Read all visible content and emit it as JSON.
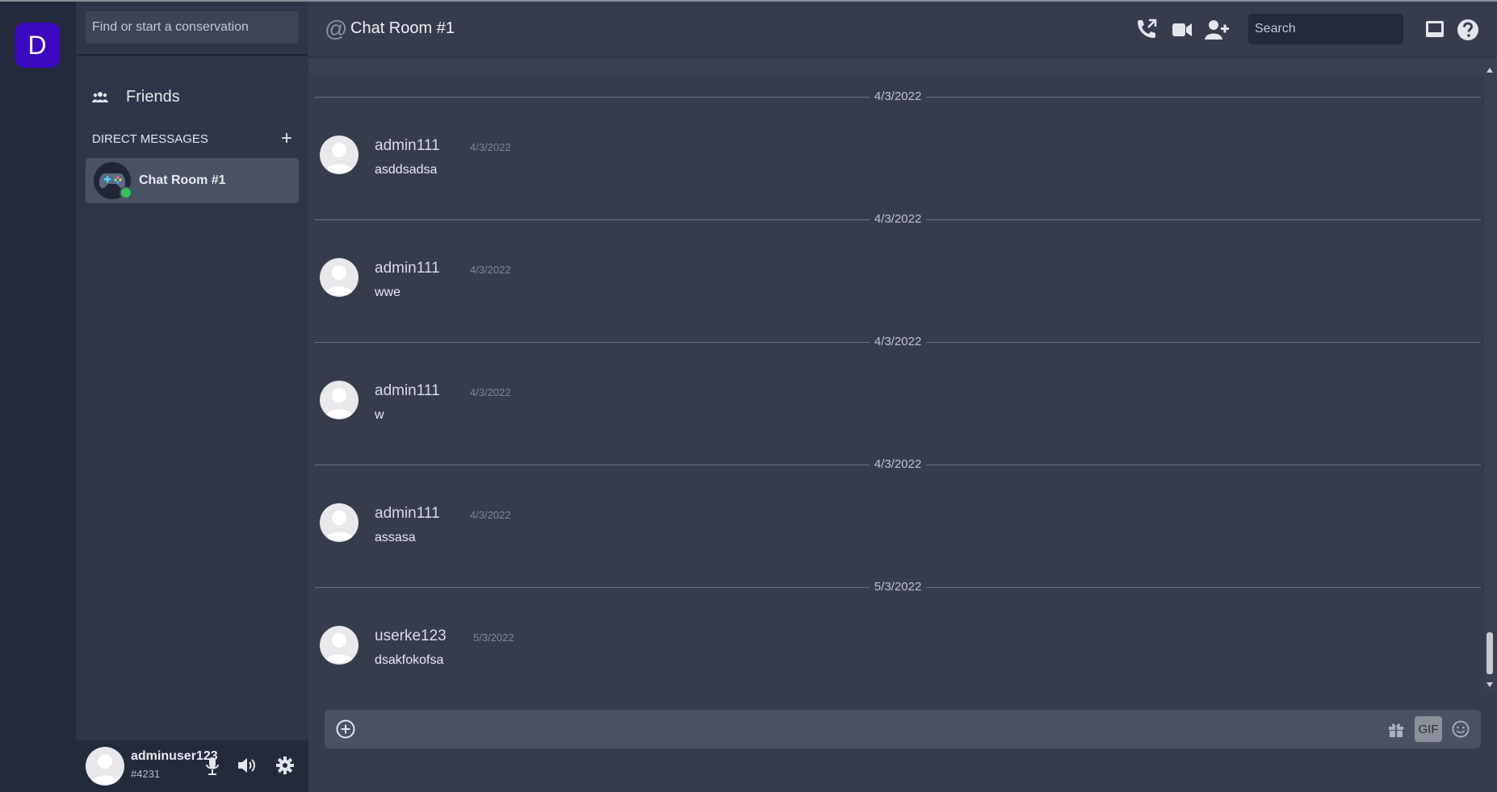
{
  "server": {
    "letter": "D"
  },
  "sidebar": {
    "search_placeholder": "Find or start a conservation",
    "friends_label": "Friends",
    "dm_header": "DIRECT MESSAGES",
    "dm_add": "+",
    "dm_items": [
      {
        "label": "Chat Room #1",
        "status": "online"
      }
    ]
  },
  "user": {
    "name": "adminuser123",
    "tag": "#4231"
  },
  "header": {
    "at_symbol": "@",
    "title": "Chat Room #1",
    "search_placeholder": "Search"
  },
  "messages": [
    {
      "divider": "4/3/2022",
      "author": "admin111",
      "date": "4/3/2022",
      "text": "asddsadsa"
    },
    {
      "divider": "4/3/2022",
      "author": "admin111",
      "date": "4/3/2022",
      "text": "wwe"
    },
    {
      "divider": "4/3/2022",
      "author": "admin111",
      "date": "4/3/2022",
      "text": "w"
    },
    {
      "divider": "4/3/2022",
      "author": "admin111",
      "date": "4/3/2022",
      "text": "assasa"
    },
    {
      "divider": "5/3/2022",
      "author": "userke123",
      "date": "5/3/2022",
      "text": "dsakfokofsa"
    }
  ],
  "composer": {
    "gif_label": "GIF",
    "value": ""
  },
  "icons": {
    "friends": "people-icon",
    "call": "phone-call-icon",
    "video": "video-camera-icon",
    "add_friend": "add-user-icon",
    "inbox": "inbox-icon",
    "help": "help-icon",
    "mic": "microphone-icon",
    "speaker": "speaker-icon",
    "settings": "gear-icon",
    "attach": "plus-circle-icon",
    "gift": "gift-icon",
    "emoji": "smiley-icon"
  },
  "colors": {
    "server_accent": "#3c08c0",
    "online": "#2ec35b",
    "background": "#363c4c"
  }
}
